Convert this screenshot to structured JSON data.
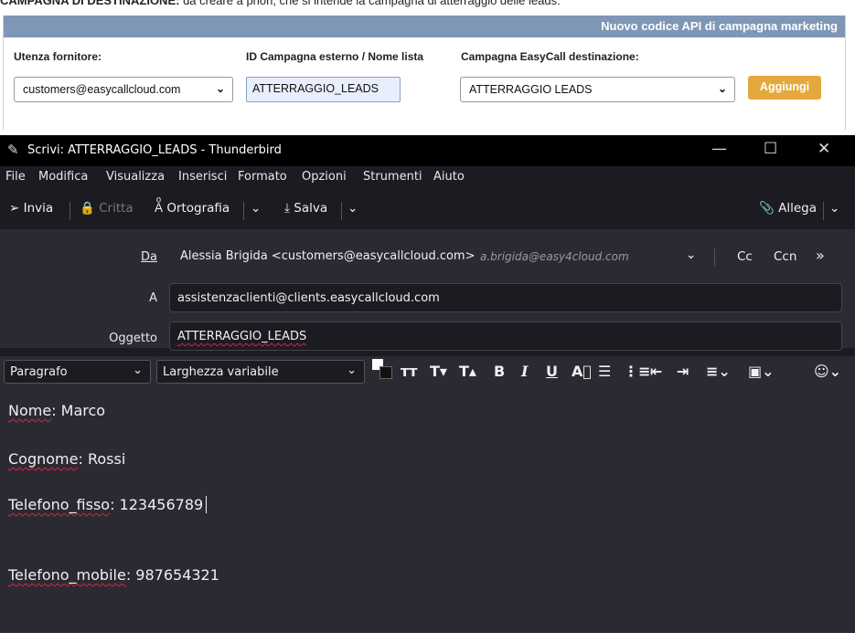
{
  "intro": {
    "bold": "CAMPAGNA DI DESTINAZIONE:",
    "text": " da creare a priori, che si intende la campagna di atterraggio delle leads."
  },
  "webform": {
    "header_title": "Nuovo codice API di campagna marketing",
    "labels": {
      "utenza": "Utenza fornitore:",
      "id_campagna": "ID Campagna esterno / Nome lista",
      "campagna_dest": "Campagna EasyCall destinazione:"
    },
    "utenza_value": "customers@easycallcloud.com",
    "id_campagna_value": "ATTERRAGGIO_LEADS",
    "campagna_dest_value": "ATTERRAGGIO LEADS",
    "add_button": "Aggiungi"
  },
  "window": {
    "title": "Scrivi: ATTERRAGGIO_LEADS - Thunderbird",
    "controls": {
      "minimize": "—",
      "maximize": "☐",
      "close": "✕"
    }
  },
  "menu": [
    "File",
    "Modifica",
    "Visualizza",
    "Inserisci",
    "Formato",
    "Opzioni",
    "Strumenti",
    "Aiuto"
  ],
  "toolbar": {
    "send": "Invia",
    "encrypt": "Critta",
    "spelling": "Ortografia",
    "save": "Salva",
    "attach": "Allega"
  },
  "headers": {
    "from_label": "Da",
    "from_value": "Alessia Brigida <customers@easycallcloud.com>",
    "from_identity": "a.brigida@easy4cloud.com",
    "cc": "Cc",
    "bcc": "Ccn",
    "to_label": "A",
    "to_value": "assistenzaclienti@clients.easycallcloud.com",
    "subject_label": "Oggetto",
    "subject_value": "ATTERRAGGIO_LEADS"
  },
  "format": {
    "paragraph": "Paragrafo",
    "font": "Larghezza variabile"
  },
  "body": {
    "lines": [
      {
        "key": "Nome",
        "value": ": Marco"
      },
      {
        "key": "Cognome",
        "value": ": Rossi"
      },
      {
        "key": "Telefono_fisso",
        "value": ": 123456789"
      },
      {
        "key": "Telefono_mobile",
        "value": ": 987654321"
      }
    ]
  },
  "colors": {
    "panel_header": "#7f97b6",
    "add_button": "#e3a93c",
    "tb_dark": "#1c1b22",
    "tb_panel": "#2b2a33",
    "spell_error": "#e0223a"
  }
}
